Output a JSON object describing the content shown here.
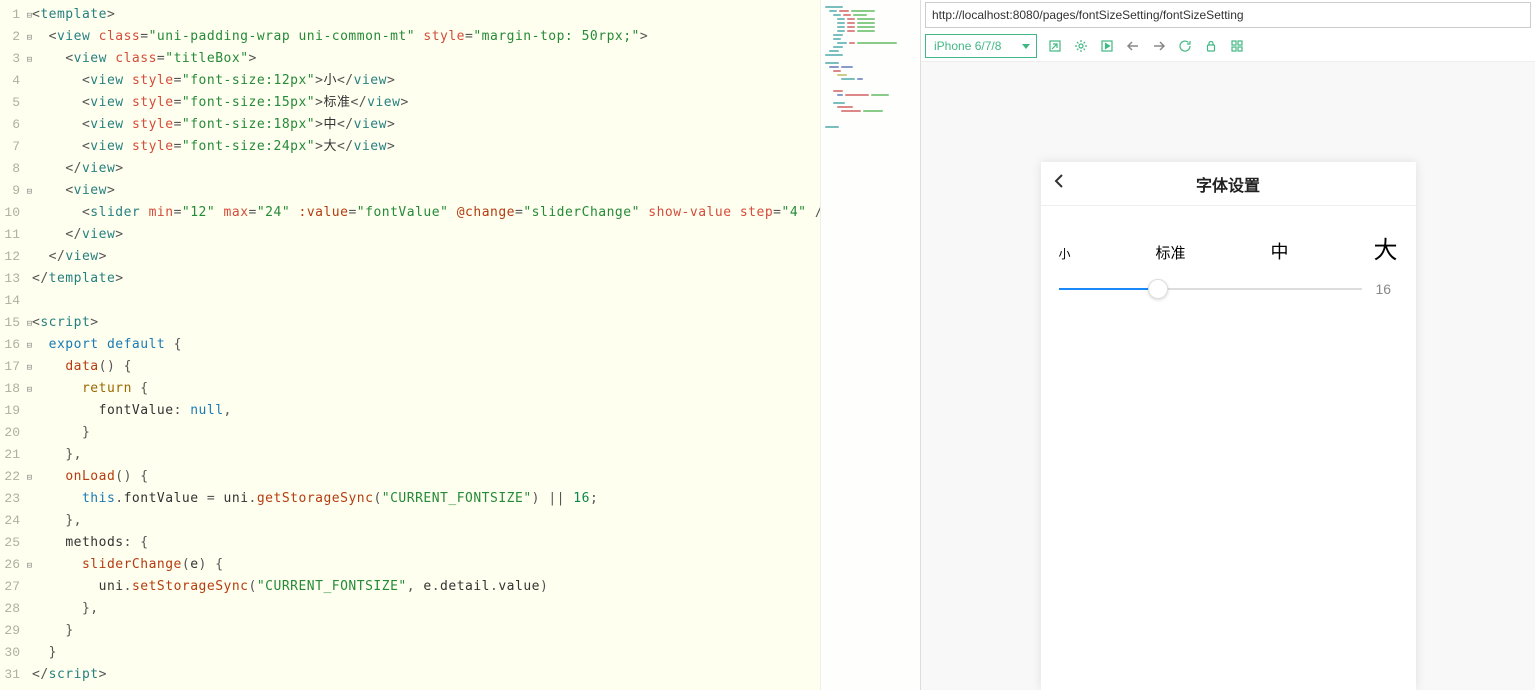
{
  "editor": {
    "lines": [
      1,
      2,
      3,
      4,
      5,
      6,
      7,
      8,
      9,
      10,
      11,
      12,
      13,
      14,
      15,
      16,
      17,
      18,
      19,
      20,
      21,
      22,
      23,
      24,
      25,
      26,
      27,
      28,
      29,
      30,
      31
    ],
    "fold_lines": [
      1,
      2,
      3,
      9,
      15,
      16,
      17,
      18,
      22,
      26
    ],
    "code": {
      "tag_template": "template",
      "tag_view": "view",
      "tag_slider": "slider",
      "tag_script": "script",
      "attr_class": "class",
      "attr_style": "style",
      "attr_min": "min",
      "attr_max": "max",
      "attr_value": ":value",
      "attr_change": "@change",
      "attr_showvalue": "show-value",
      "attr_step": "step",
      "cls_wrap": "\"uni-padding-wrap uni-common-mt\"",
      "sty_mt": "\"margin-top: 50rpx;\"",
      "cls_titleBox": "\"titleBox\"",
      "sty_12": "\"font-size:12px\"",
      "sty_15": "\"font-size:15px\"",
      "sty_18": "\"font-size:18px\"",
      "sty_24": "\"font-size:24px\"",
      "txt_sm": "小",
      "txt_std": "标准",
      "txt_md": "中",
      "txt_lg": "大",
      "v_min": "\"12\"",
      "v_max": "\"24\"",
      "v_value": "\"fontValue\"",
      "v_change": "\"sliderChange\"",
      "v_step": "\"4\"",
      "kw_export": "export",
      "kw_default": "default",
      "fn_data": "data",
      "kw_return": "return",
      "prop_fontValue": "fontValue",
      "kw_null": "null",
      "fn_onLoad": "onLoad",
      "kw_this": "this",
      "obj_uni": "uni",
      "fn_getStorageSync": "getStorageSync",
      "str_key": "\"CURRENT_FONTSIZE\"",
      "num_16": "16",
      "prop_methods": "methods",
      "fn_sliderChange": "sliderChange",
      "param_e": "e",
      "fn_setStorageSync": "setStorageSync",
      "prop_detail": "detail",
      "prop_value": "value"
    }
  },
  "browser": {
    "url": "http://localhost:8080/pages/fontSizeSetting/fontSizeSetting",
    "device": "iPhone 6/7/8"
  },
  "preview": {
    "page_title": "字体设置",
    "labels": {
      "sm": "小",
      "std": "标准",
      "md": "中",
      "lg": "大"
    },
    "slider_value": "16",
    "slider_min": 12,
    "slider_max": 24
  }
}
